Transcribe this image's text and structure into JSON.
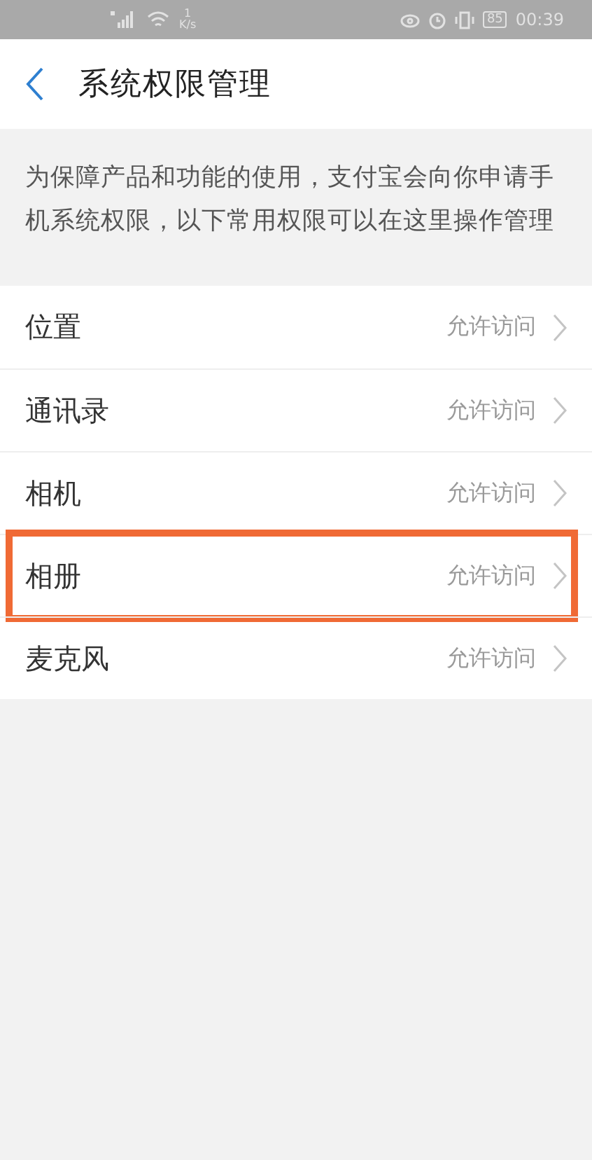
{
  "status_bar": {
    "net_speed_value": "1",
    "net_speed_unit": "K/s",
    "battery": "85",
    "time": "00:39"
  },
  "header": {
    "title": "系统权限管理"
  },
  "description": "为保障产品和功能的使用，支付宝会向你申请手机系统权限，以下常用权限可以在这里操作管理",
  "permissions": [
    {
      "label": "位置",
      "status": "允许访问",
      "highlighted": false
    },
    {
      "label": "通讯录",
      "status": "允许访问",
      "highlighted": false
    },
    {
      "label": "相机",
      "status": "允许访问",
      "highlighted": false
    },
    {
      "label": "相册",
      "status": "允许访问",
      "highlighted": true
    },
    {
      "label": "麦克风",
      "status": "允许访问",
      "highlighted": false
    }
  ]
}
